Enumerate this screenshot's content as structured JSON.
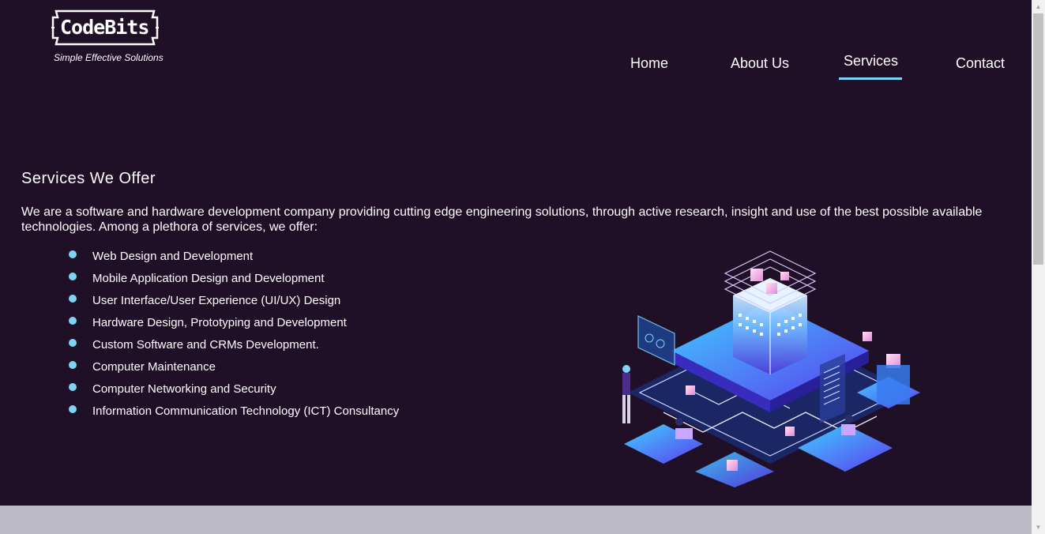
{
  "brand": {
    "name": "CodeBits",
    "tagline": "Simple Effective Solutions"
  },
  "nav": {
    "home": "Home",
    "about": "About Us",
    "services": "Services",
    "contact": "Contact",
    "active": "Services"
  },
  "content": {
    "heading": "Services We Offer",
    "intro": "We are a software and hardware development company providing cutting edge engineering solutions, through active research, insight and use of the best possible available technologies. Among a plethora of services, we offer:",
    "services": [
      "Web Design and Development",
      "Mobile Application Design and Development",
      "User Interface/User Experience (UI/UX) Design",
      "Hardware Design, Prototyping and Development",
      "Custom Software and CRMs Development.",
      "Computer Maintenance",
      "Computer Networking and Security",
      "Information Communication Technology (ICT) Consultancy"
    ]
  },
  "colors": {
    "background": "#1f0f27",
    "accent": "#7fd3f5",
    "footer": "#bcbac6"
  },
  "icons": {
    "scroll_up": "triangle-up-icon",
    "scroll_down": "triangle-down-icon"
  }
}
